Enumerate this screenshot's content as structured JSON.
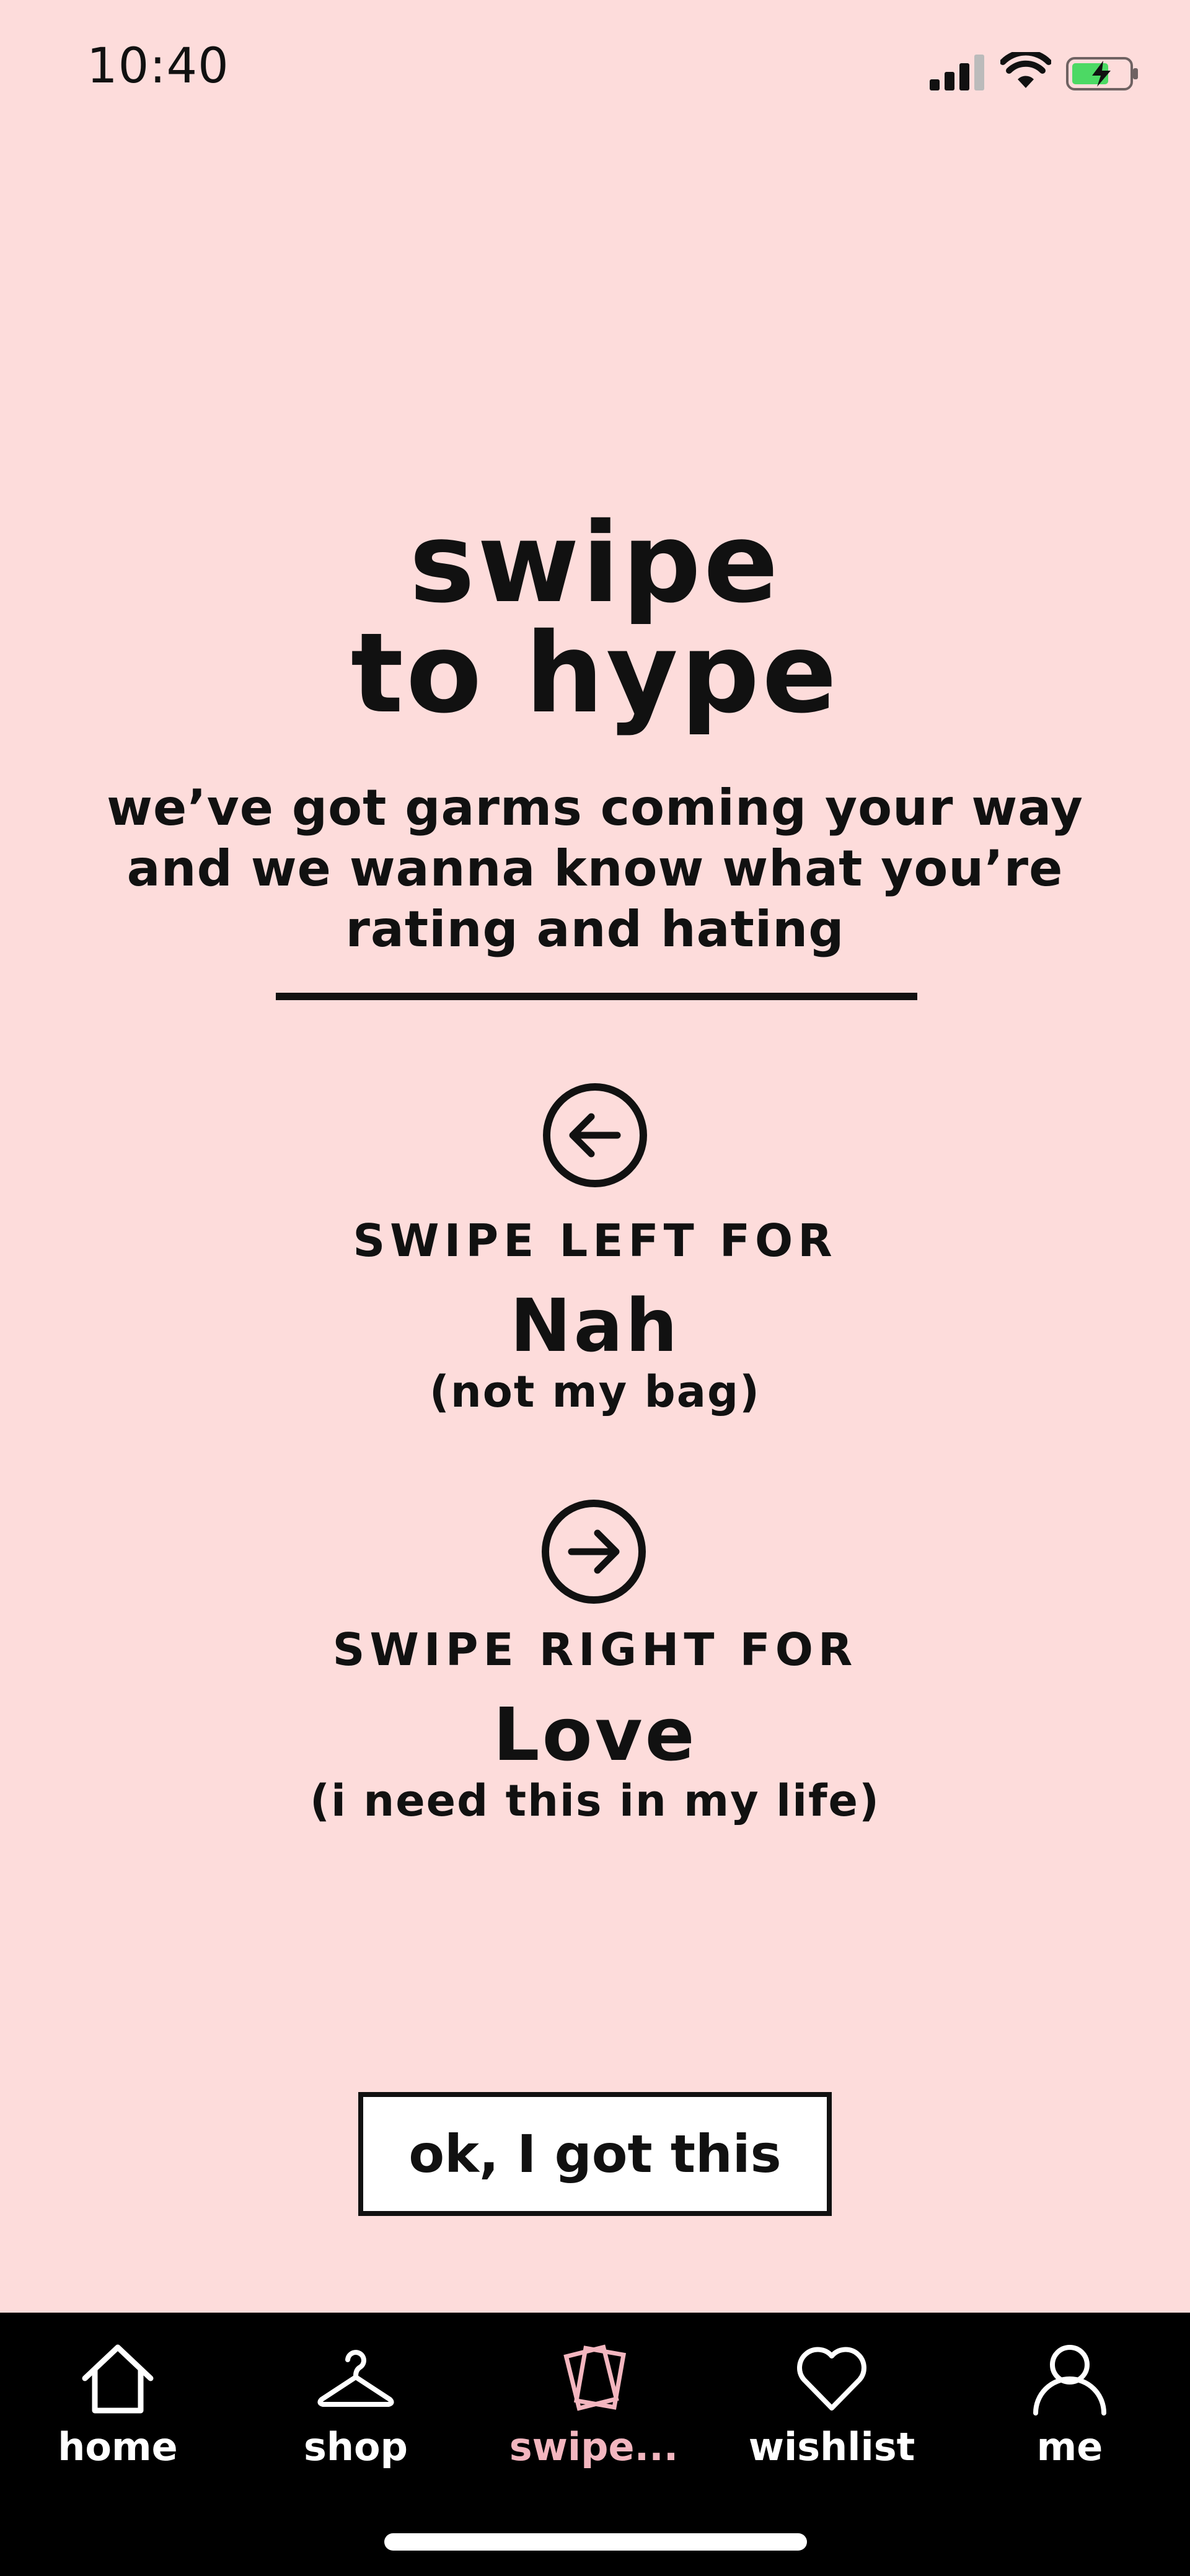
{
  "status_bar": {
    "time": "10:40",
    "icons": [
      "signal-icon",
      "wifi-icon",
      "battery-charging-icon"
    ]
  },
  "intro": {
    "title_line1": "swipe",
    "title_line2": "to hype",
    "subtitle_line1": "we’ve got garms coming your way",
    "subtitle_line2": "and we wanna know what you’re",
    "subtitle_line3": "rating and hating"
  },
  "instructions": {
    "left": {
      "icon": "arrow-left-circle-icon",
      "label": "SWIPE LEFT FOR",
      "value": "Nah",
      "desc": "(not my bag)"
    },
    "right": {
      "icon": "arrow-right-circle-icon",
      "label": "SWIPE RIGHT FOR",
      "value": "Love",
      "desc": "(i need this in my life)"
    }
  },
  "cta": {
    "label": "ok, I got this"
  },
  "tab_bar": {
    "active_color": "#f3b6bf",
    "items": [
      {
        "label": "home",
        "icon": "home-icon"
      },
      {
        "label": "shop",
        "icon": "hanger-icon"
      },
      {
        "label": "swipe...",
        "icon": "swipe-cards-icon"
      },
      {
        "label": "wishlist",
        "icon": "heart-icon"
      },
      {
        "label": "me",
        "icon": "user-icon"
      }
    ]
  },
  "colors": {
    "background": "#fddcdb",
    "text": "#111111",
    "tab_bar": "#000000",
    "battery_fill": "#4cd964"
  }
}
